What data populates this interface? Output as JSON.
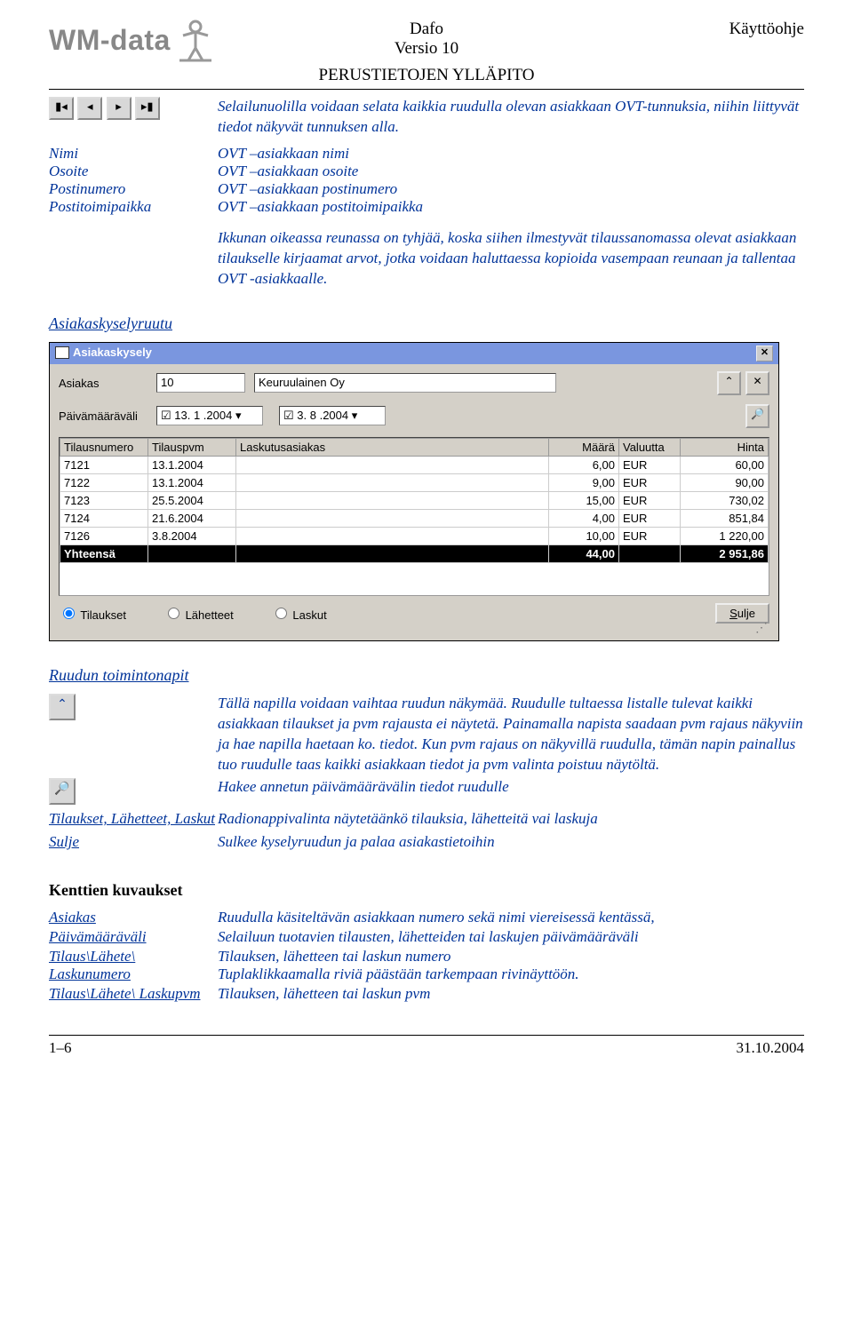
{
  "header": {
    "logo": "WM-data",
    "title": "Dafo",
    "version": "Versio 10",
    "right": "Käyttöohje",
    "section": "PERUSTIETOJEN YLLÄPITO"
  },
  "intro_para": "Selailunuolilla voidaan selata kaikkia ruudulla olevan asiakkaan OVT-tunnuksia, niihin liittyvät tiedot näkyvät tunnuksen alla.",
  "field_defs": [
    {
      "label": "Nimi",
      "desc": "OVT –asiakkaan nimi"
    },
    {
      "label": "Osoite",
      "desc": "OVT –asiakkaan osoite"
    },
    {
      "label": "Postinumero",
      "desc": "OVT –asiakkaan postinumero"
    },
    {
      "label": "Postitoimipaikka",
      "desc": "OVT –asiakkaan postitoimipaikka"
    }
  ],
  "para2": "Ikkunan oikeassa reunassa on tyhjää, koska siihen ilmestyvät tilaussanomassa olevat asiakkaan tilaukselle kirjaamat arvot, jotka voidaan haluttaessa kopioida vasempaan reunaan ja tallentaa OVT -asiakkaalle.",
  "heading_asiakas": "Asiakaskyselyruutu",
  "win": {
    "title": "Asiakaskysely",
    "asiakas_label": "Asiakas",
    "asiakas_code": "10",
    "asiakas_name": "Keuruulainen Oy",
    "date_label": "Päivämääräväli",
    "date_from": "13. 1 .2004",
    "date_to": "3. 8 .2004",
    "columns": [
      "Tilausnumero",
      "Tilauspvm",
      "Laskutusasiakas",
      "Määrä",
      "Valuutta",
      "Hinta"
    ],
    "rows": [
      {
        "no": "7121",
        "pvm": "13.1.2004",
        "lask": "",
        "maara": "6,00",
        "val": "EUR",
        "hinta": "60,00"
      },
      {
        "no": "7122",
        "pvm": "13.1.2004",
        "lask": "",
        "maara": "9,00",
        "val": "EUR",
        "hinta": "90,00"
      },
      {
        "no": "7123",
        "pvm": "25.5.2004",
        "lask": "",
        "maara": "15,00",
        "val": "EUR",
        "hinta": "730,02"
      },
      {
        "no": "7124",
        "pvm": "21.6.2004",
        "lask": "",
        "maara": "4,00",
        "val": "EUR",
        "hinta": "851,84"
      },
      {
        "no": "7126",
        "pvm": "3.8.2004",
        "lask": "",
        "maara": "10,00",
        "val": "EUR",
        "hinta": "1 220,00"
      }
    ],
    "total_label": "Yhteensä",
    "total_maara": "44,00",
    "total_hinta": "2 951,86",
    "radio1": "Tilaukset",
    "radio2": "Lähetteet",
    "radio3": "Laskut",
    "close": "Sulje"
  },
  "heading_ruudun": "Ruudun toimintonapit",
  "button_desc1": "Tällä napilla voidaan vaihtaa ruudun näkymää. Ruudulle tultaessa listalle tulevat kaikki asiakkaan tilaukset ja pvm rajausta ei näytetä. Painamalla napista saadaan pvm rajaus näkyviin ja hae napilla haetaan ko. tiedot. Kun pvm rajaus on näkyvillä ruudulla, tämän napin painallus tuo ruudulle taas kaikki asiakkaan tiedot ja pvm valinta poistuu näytöltä.",
  "button_desc2": "Hakee annetun päivämäärävälin tiedot ruudulle",
  "row_tilaukset_label": "Tilaukset, Lähetteet, Laskut",
  "row_tilaukset_desc": "Radionappivalinta näytetäänkö tilauksia, lähetteitä vai laskuja",
  "row_sulje_label": "Sulje",
  "row_sulje_desc": "Sulkee kyselyruudun ja palaa asiakastietoihin",
  "heading_kentat": "Kenttien kuvaukset",
  "kentat": [
    {
      "label": "Asiakas",
      "desc": "Ruudulla käsiteltävän asiakkaan numero sekä nimi viereisessä kentässä,"
    },
    {
      "label": "Päivämääräväli",
      "desc": "Selailuun tuotavien tilausten, lähetteiden tai laskujen päivämääräväli"
    },
    {
      "label": "Tilaus\\Lähete\\ Laskunumero",
      "desc": "Tilauksen, lähetteen tai laskun numero\nTuplaklikkaamalla riviä päästään tarkempaan rivinäyttöön."
    },
    {
      "label": "Tilaus\\Lähete\\ Laskupvm",
      "desc": "Tilauksen, lähetteen tai laskun pvm"
    }
  ],
  "footer": {
    "left": "1–6",
    "right": "31.10.2004"
  }
}
